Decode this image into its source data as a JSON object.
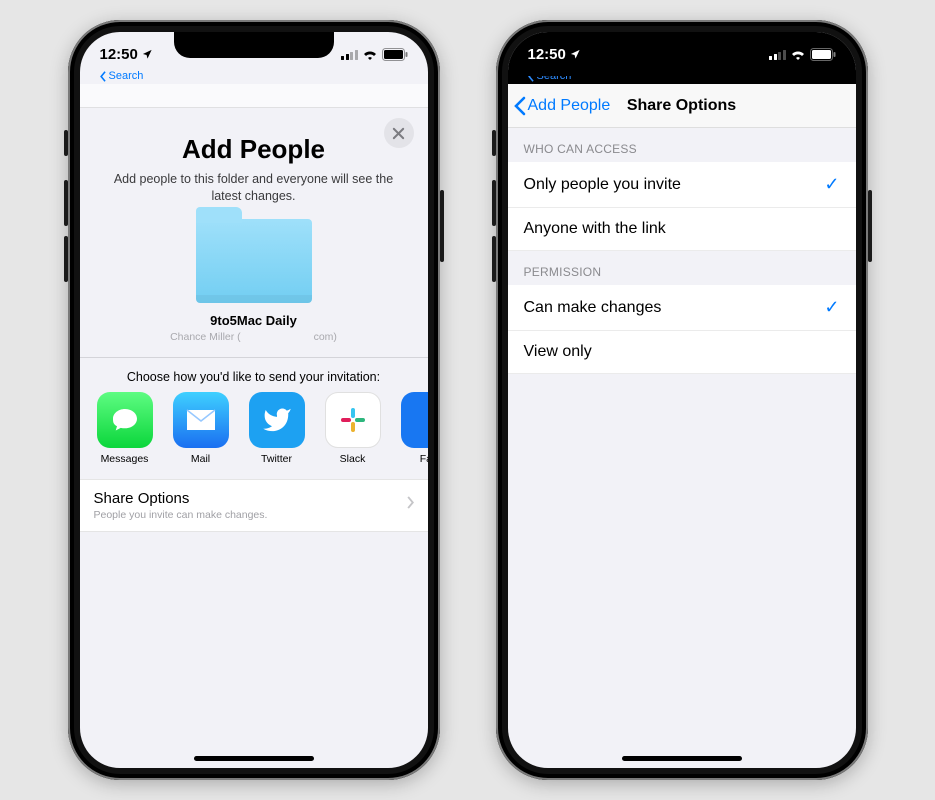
{
  "status": {
    "time": "12:50",
    "back_search_label": "Search"
  },
  "left": {
    "title": "Add People",
    "subtitle": "Add people to this folder and everyone will see the latest changes.",
    "folder_name": "9to5Mac Daily",
    "folder_owner": "Chance Miller (                         com)",
    "invite_caption": "Choose how you'd like to send your invitation:",
    "apps": [
      {
        "label": "Messages"
      },
      {
        "label": "Mail"
      },
      {
        "label": "Twitter"
      },
      {
        "label": "Slack"
      },
      {
        "label": "Fac"
      }
    ],
    "share_options": {
      "title": "Share Options",
      "subtitle": "People you invite can make changes."
    }
  },
  "right": {
    "nav_back": "Add People",
    "nav_title": "Share Options",
    "sections": [
      {
        "header": "WHO CAN ACCESS",
        "rows": [
          {
            "label": "Only people you invite",
            "selected": true
          },
          {
            "label": "Anyone with the link",
            "selected": false
          }
        ]
      },
      {
        "header": "PERMISSION",
        "rows": [
          {
            "label": "Can make changes",
            "selected": true
          },
          {
            "label": "View only",
            "selected": false
          }
        ]
      }
    ]
  }
}
